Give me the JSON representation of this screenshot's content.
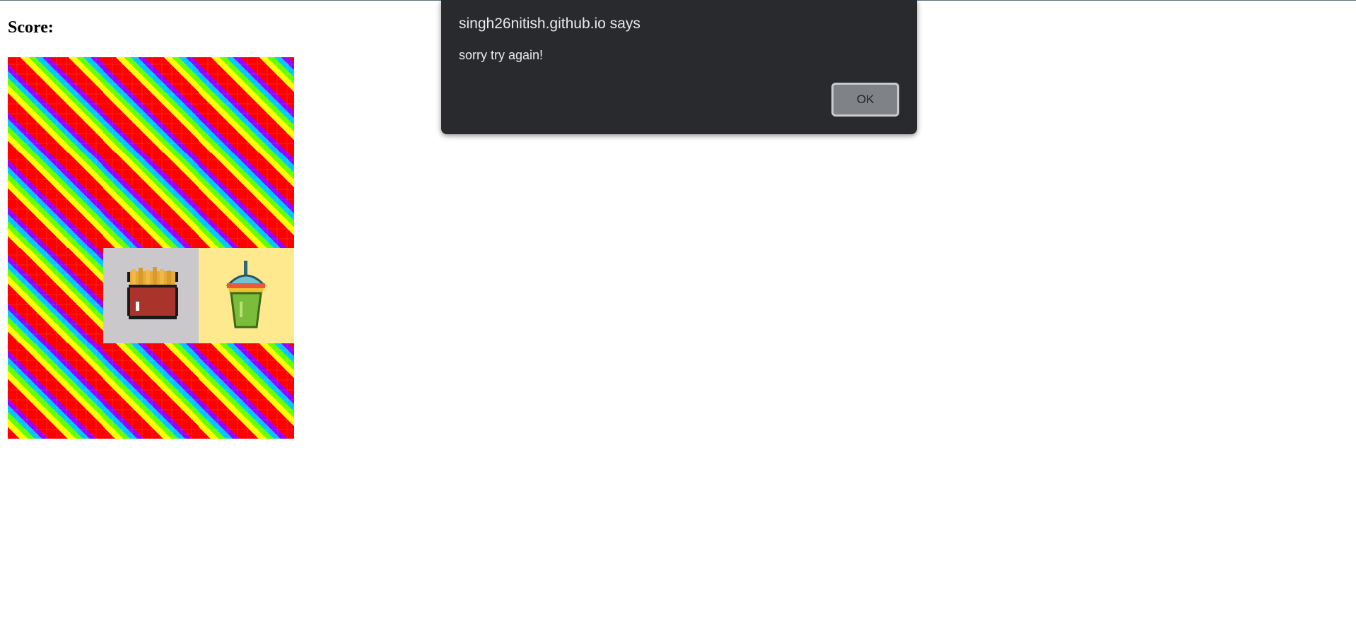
{
  "page": {
    "score_label": "Score:"
  },
  "board": {
    "rows": 4,
    "cols": 3,
    "tiles": [
      {
        "state": "hidden"
      },
      {
        "state": "hidden"
      },
      {
        "state": "hidden"
      },
      {
        "state": "hidden"
      },
      {
        "state": "hidden"
      },
      {
        "state": "hidden"
      },
      {
        "state": "hidden"
      },
      {
        "state": "revealed",
        "item": "fries-icon",
        "background": "#cbc8cc"
      },
      {
        "state": "revealed",
        "item": "drink-cup-icon",
        "background": "#ffe98f"
      },
      {
        "state": "hidden"
      },
      {
        "state": "hidden"
      },
      {
        "state": "hidden"
      }
    ]
  },
  "dialog": {
    "title": "singh26nitish.github.io says",
    "message": "sorry try again!",
    "ok_label": "OK",
    "background": "#292a2d"
  }
}
